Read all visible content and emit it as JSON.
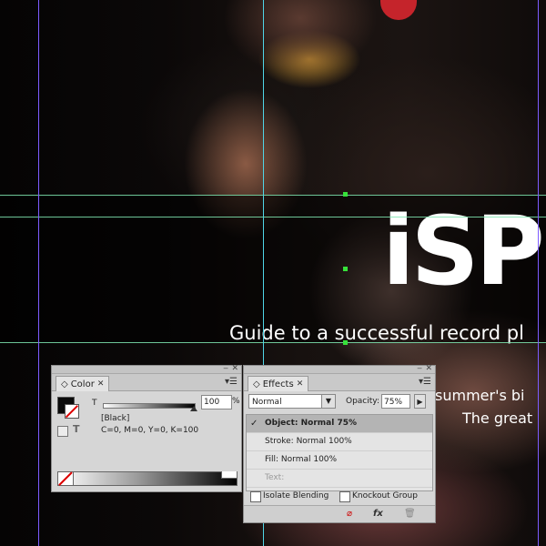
{
  "artwork": {
    "headline": "iSP",
    "tagline": "Guide to a successful record pl",
    "sub_line_1": "summer's bi",
    "sub_line_2": "The great"
  },
  "color_panel": {
    "tab_label": "Color",
    "tint_label": "T",
    "tint_value": "100",
    "tint_unit": "%",
    "swatch_name": "[Black]",
    "cmyk_values": "C=0, M=0, Y=0, K=100",
    "accent": "#0a0a0a"
  },
  "effects_panel": {
    "tab_label": "Effects",
    "blend_mode": "Normal",
    "opacity_label": "Opacity:",
    "opacity_value": "75%",
    "rows": [
      {
        "label": "Object: Normal 75%",
        "selected": true,
        "check": "✓"
      },
      {
        "label": "Stroke:  Normal 100%"
      },
      {
        "label": "Fill:  Normal 100%"
      },
      {
        "label": "Text:",
        "disabled": true
      }
    ],
    "isolate_label": "Isolate Blending",
    "knockout_label": "Knockout Group",
    "fx_label": "fx"
  },
  "icons": {
    "close": "close-icon",
    "menu": "panel-menu-icon",
    "trash": "trash-icon",
    "clear": "clear-effects-icon",
    "fx": "fx-icon"
  }
}
